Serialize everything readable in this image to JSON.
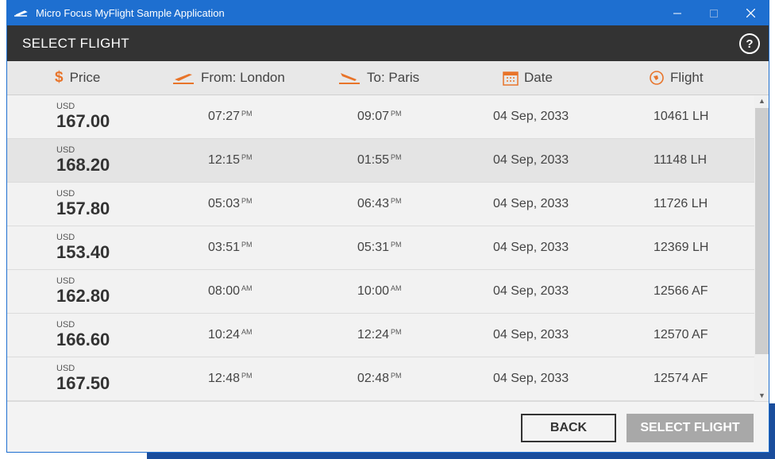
{
  "window": {
    "title": "Micro Focus MyFlight Sample Application"
  },
  "header": {
    "title": "SELECT FLIGHT",
    "help_label": "?"
  },
  "columns": {
    "price": "Price",
    "from": "From: London",
    "to": "To: Paris",
    "date": "Date",
    "flight": "Flight"
  },
  "colors": {
    "accent": "#e8742a",
    "titlebar": "#1e6fd0",
    "header": "#333333"
  },
  "flights": [
    {
      "currency": "USD",
      "price": "167.00",
      "dep": "07:27",
      "dep_ampm": "PM",
      "arr": "09:07",
      "arr_ampm": "PM",
      "date": "04 Sep, 2033",
      "flight": "10461 LH"
    },
    {
      "currency": "USD",
      "price": "168.20",
      "dep": "12:15",
      "dep_ampm": "PM",
      "arr": "01:55",
      "arr_ampm": "PM",
      "date": "04 Sep, 2033",
      "flight": "11148 LH"
    },
    {
      "currency": "USD",
      "price": "157.80",
      "dep": "05:03",
      "dep_ampm": "PM",
      "arr": "06:43",
      "arr_ampm": "PM",
      "date": "04 Sep, 2033",
      "flight": "11726 LH"
    },
    {
      "currency": "USD",
      "price": "153.40",
      "dep": "03:51",
      "dep_ampm": "PM",
      "arr": "05:31",
      "arr_ampm": "PM",
      "date": "04 Sep, 2033",
      "flight": "12369 LH"
    },
    {
      "currency": "USD",
      "price": "162.80",
      "dep": "08:00",
      "dep_ampm": "AM",
      "arr": "10:00",
      "arr_ampm": "AM",
      "date": "04 Sep, 2033",
      "flight": "12566 AF"
    },
    {
      "currency": "USD",
      "price": "166.60",
      "dep": "10:24",
      "dep_ampm": "AM",
      "arr": "12:24",
      "arr_ampm": "PM",
      "date": "04 Sep, 2033",
      "flight": "12570 AF"
    },
    {
      "currency": "USD",
      "price": "167.50",
      "dep": "12:48",
      "dep_ampm": "PM",
      "arr": "02:48",
      "arr_ampm": "PM",
      "date": "04 Sep, 2033",
      "flight": "12574 AF"
    }
  ],
  "buttons": {
    "back": "BACK",
    "select": "SELECT FLIGHT"
  }
}
